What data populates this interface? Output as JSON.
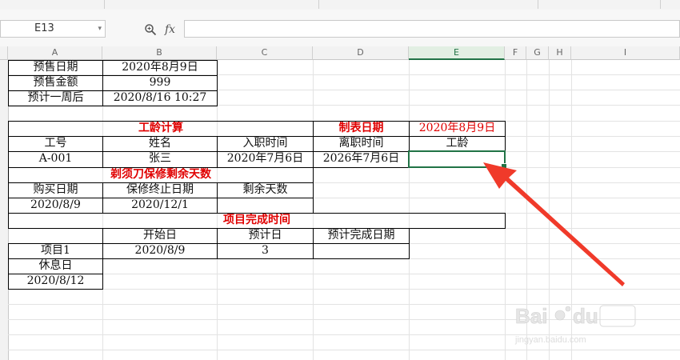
{
  "namebox": {
    "value": "E13"
  },
  "formula": {
    "fx_label": "fx",
    "value": ""
  },
  "columns": [
    "A",
    "B",
    "C",
    "D",
    "E",
    "F",
    "G",
    "H",
    "I"
  ],
  "active_column": "E",
  "cells": {
    "a1": "预售日期",
    "b1": "2020年8月9日",
    "a2": "预售金额",
    "b2": "999",
    "a3": "预计一周后",
    "b3": "2020/8/16 10:27",
    "seniority_title": "工龄计算",
    "d5": "制表日期",
    "e5": "2020年8月9日",
    "a6": "工号",
    "b6": "姓名",
    "c6": "入职时间",
    "d6": "离职时间",
    "e6": "工龄",
    "a7": "A-001",
    "b7": "张三",
    "c7": "2020年7月6日",
    "d7": "2026年7月6日",
    "e7": "",
    "warranty_title": "剃须刀保修剩余天数",
    "a9": "购买日期",
    "b9": "保修终止日期",
    "c9": "剩余天数",
    "a10": "2020/8/9",
    "b10": "2020/12/1",
    "project_title": "项目完成时间",
    "b12": "开始日",
    "c12": "预计日",
    "d12": "预计完成日期",
    "a13": "项目1",
    "b13": "2020/8/9",
    "c13": "3",
    "a14": "休息日",
    "a15": "2020/8/12"
  },
  "colors": {
    "accent": "#217346",
    "red_text": "#e00000",
    "arrow": "#f03a2a"
  }
}
